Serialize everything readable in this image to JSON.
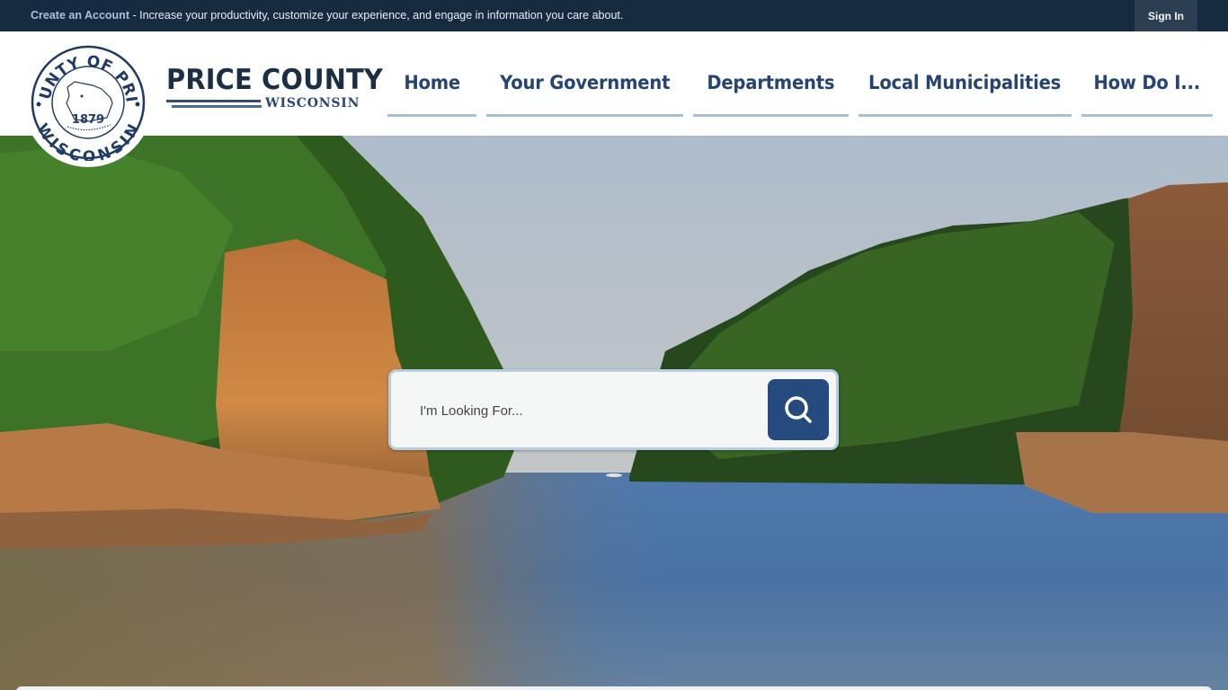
{
  "topbar": {
    "create_account_label": "Create an Account",
    "message": " - Increase your productivity, customize your experience, and engage in information you care about.",
    "sign_in_label": "Sign In"
  },
  "brand": {
    "title": "PRICE COUNTY",
    "subtitle": "WISCONSIN",
    "seal": {
      "top_text": "COUNTY OF PRICE",
      "bottom_text": "WISCONSIN",
      "year": "1879"
    },
    "colors": {
      "primary": "#1b2e44",
      "accent": "#264472",
      "nav_underline": "#a6c1d5",
      "topbar": "#172b40"
    }
  },
  "nav": {
    "items": [
      {
        "label": "Home"
      },
      {
        "label": "Your Government"
      },
      {
        "label": "Departments"
      },
      {
        "label": "Local Municipalities"
      },
      {
        "label": "How Do I..."
      }
    ]
  },
  "hero": {
    "image_description": "river-canyon-with-sandstone-cliffs-and-pines"
  },
  "search": {
    "placeholder": "I'm Looking For...",
    "value": "",
    "button_icon": "search-icon"
  }
}
